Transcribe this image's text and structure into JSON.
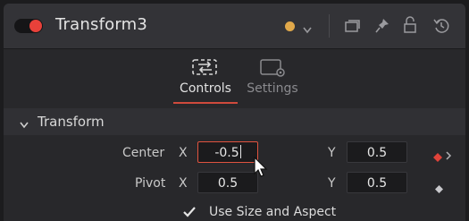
{
  "header": {
    "title": "Transform3",
    "accent_color": "#e8413a",
    "node_color": "#e0a84a",
    "icons": [
      "color-dot-icon",
      "chevron-down-icon",
      "versions-icon",
      "pin-icon",
      "lock-icon",
      "reset-icon"
    ]
  },
  "tabs": [
    {
      "label": "Controls",
      "icon": "controls-icon",
      "active": true
    },
    {
      "label": "Settings",
      "icon": "settings-icon",
      "active": false
    }
  ],
  "section": {
    "title": "Transform"
  },
  "center": {
    "label": "Center",
    "x_label": "X",
    "x_value": "-0.5",
    "y_label": "Y",
    "y_value": "0.5"
  },
  "pivot": {
    "label": "Pivot",
    "x_label": "X",
    "x_value": "0.5",
    "y_label": "Y",
    "y_value": "0.5"
  },
  "use_size_aspect": {
    "label": "Use Size and Aspect",
    "checked": true
  }
}
